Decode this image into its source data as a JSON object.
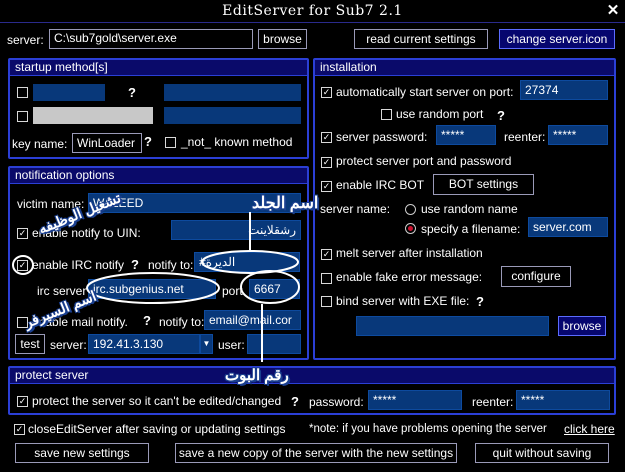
{
  "window": {
    "title": "EditServer for Sub7 2.1",
    "close": "✕"
  },
  "top": {
    "server_label": "server:",
    "server_path": "C:\\sub7gold\\server.exe",
    "browse": "browse",
    "read_settings": "read current settings",
    "change_icon": "change server.icon"
  },
  "startup": {
    "title": "startup method[s]",
    "q": "?",
    "key_name_label": "key name:",
    "key_name_value": "WinLoader",
    "not_known": "_not_ known method"
  },
  "notify": {
    "title": "notification options",
    "victim_label": "victim name:",
    "victim_value": "WALEED",
    "uin_label": "enable notify to UIN:",
    "uin_value": "رشقلاينت",
    "irc_label": "enable IRC notify",
    "notify_to_label": "notify to:",
    "irc_channel": "#الديرة",
    "irc_server_label": "irc server",
    "irc_server_value": "irc.subgenius.net",
    "port_label": "port",
    "port_value": "6667",
    "mail_label": "enable mail notify.",
    "mail_to_label": "notify to:",
    "mail_value": "email@mail.cor",
    "test": "test",
    "server_label": "server:",
    "server_value": "192.41.3.130",
    "user_label": "user:"
  },
  "install": {
    "title": "installation",
    "autostart_label": "automatically start server on port:",
    "port_value": "27374",
    "random_port": "use random port",
    "password_label": "server password:",
    "password_value": "*****",
    "reenter_label": "reenter:",
    "reenter_value": "*****",
    "protect_port": "protect server port and password",
    "irc_bot": "enable IRC BOT",
    "bot_settings": "BOT settings",
    "server_name_label": "server name:",
    "random_name": "use random name",
    "specify": "specify a filename:",
    "filename": "server.com",
    "melt": "melt server after installation",
    "fake_error": "enable fake error message:",
    "configure": "configure",
    "bind": "bind server with EXE file:",
    "browse": "browse"
  },
  "protect": {
    "title": "protect server",
    "label": "protect the server so it can't be edited/changed",
    "password_label": "password:",
    "password_value": "*****",
    "reenter_label": "reenter:",
    "reenter_value": "*****"
  },
  "footer": {
    "close_label": "closeEditServer after saving or updating settings",
    "note": "*note: if you have problems opening the server",
    "click_here": "click here",
    "save_new": "save new settings",
    "save_copy": "save a new copy of the server with the new settings",
    "quit": "quit without saving"
  },
  "annotations": {
    "folder_name": "اسم الجلد",
    "enable_function": "تشغيل الوظيفه",
    "server_name": "اسم السيرفر",
    "bot_number": "رقم البوت"
  }
}
